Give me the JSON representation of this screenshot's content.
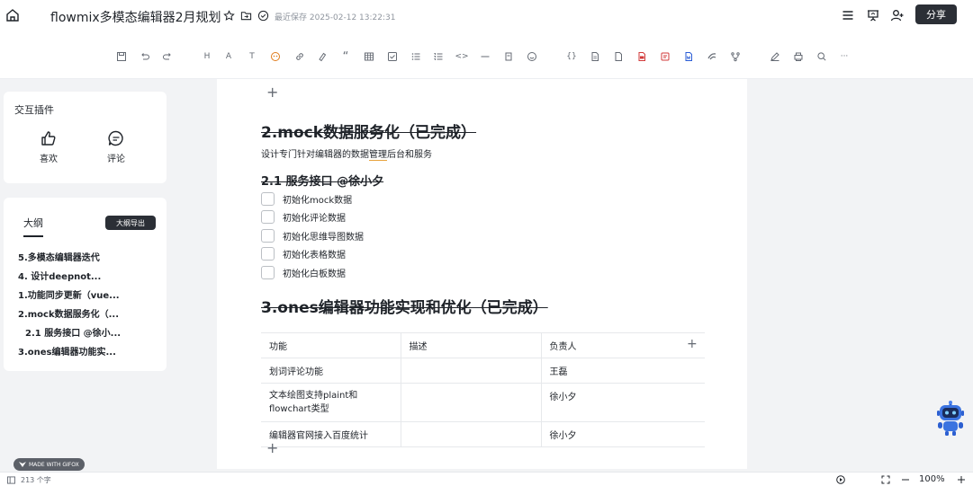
{
  "header": {
    "title": "flowmix多模态编辑器2月规划",
    "saved_status": "最近保存 2025-02-12 13:22:31",
    "share_label": "分享"
  },
  "toolbar": {
    "h_label": "H",
    "font_label": "A",
    "text_label": "T",
    "quote_label": "“",
    "code_label": "<>",
    "braces_label": "{}",
    "more_label": "···"
  },
  "plugins": {
    "title": "交互插件",
    "like_label": "喜欢",
    "comment_label": "评论"
  },
  "outline": {
    "tab_label": "大纲",
    "button_label": "大纲导出",
    "items": [
      "5.多模态编辑器迭代",
      "4. 设计deepnot...",
      "1.功能同步更新（vue...",
      "2.mock数据服务化（...",
      "2.1 服务接口 @徐小...",
      "3.ones编辑器功能实..."
    ]
  },
  "doc": {
    "h2_mock": "2.mock数据服务化（已完成）",
    "para_prefix": "设计专门针对编辑器的数据",
    "para_underline": "管理",
    "para_suffix": "后台和服务",
    "h3_service": "2.1 服务接口 @徐小夕",
    "todos": [
      "初始化mock数据",
      "初始化评论数据",
      "初始化思维导图数据",
      "初始化表格数据",
      "初始化白板数据"
    ],
    "h2_ones": "3.ones编辑器功能实现和优化（已完成）",
    "table": {
      "headers": [
        "功能",
        "描述",
        "负责人"
      ],
      "rows": [
        [
          "划词评论功能",
          "",
          "王磊"
        ],
        [
          "文本绘图支持plaint和flowchart类型",
          "",
          "徐小夕"
        ],
        [
          "编辑器官网接入百度统计",
          "",
          "徐小夕"
        ]
      ]
    }
  },
  "status": {
    "word_count": "213 个字",
    "zoom": "100%"
  },
  "watermark": {
    "label": "MADE WITH GIFOX"
  }
}
